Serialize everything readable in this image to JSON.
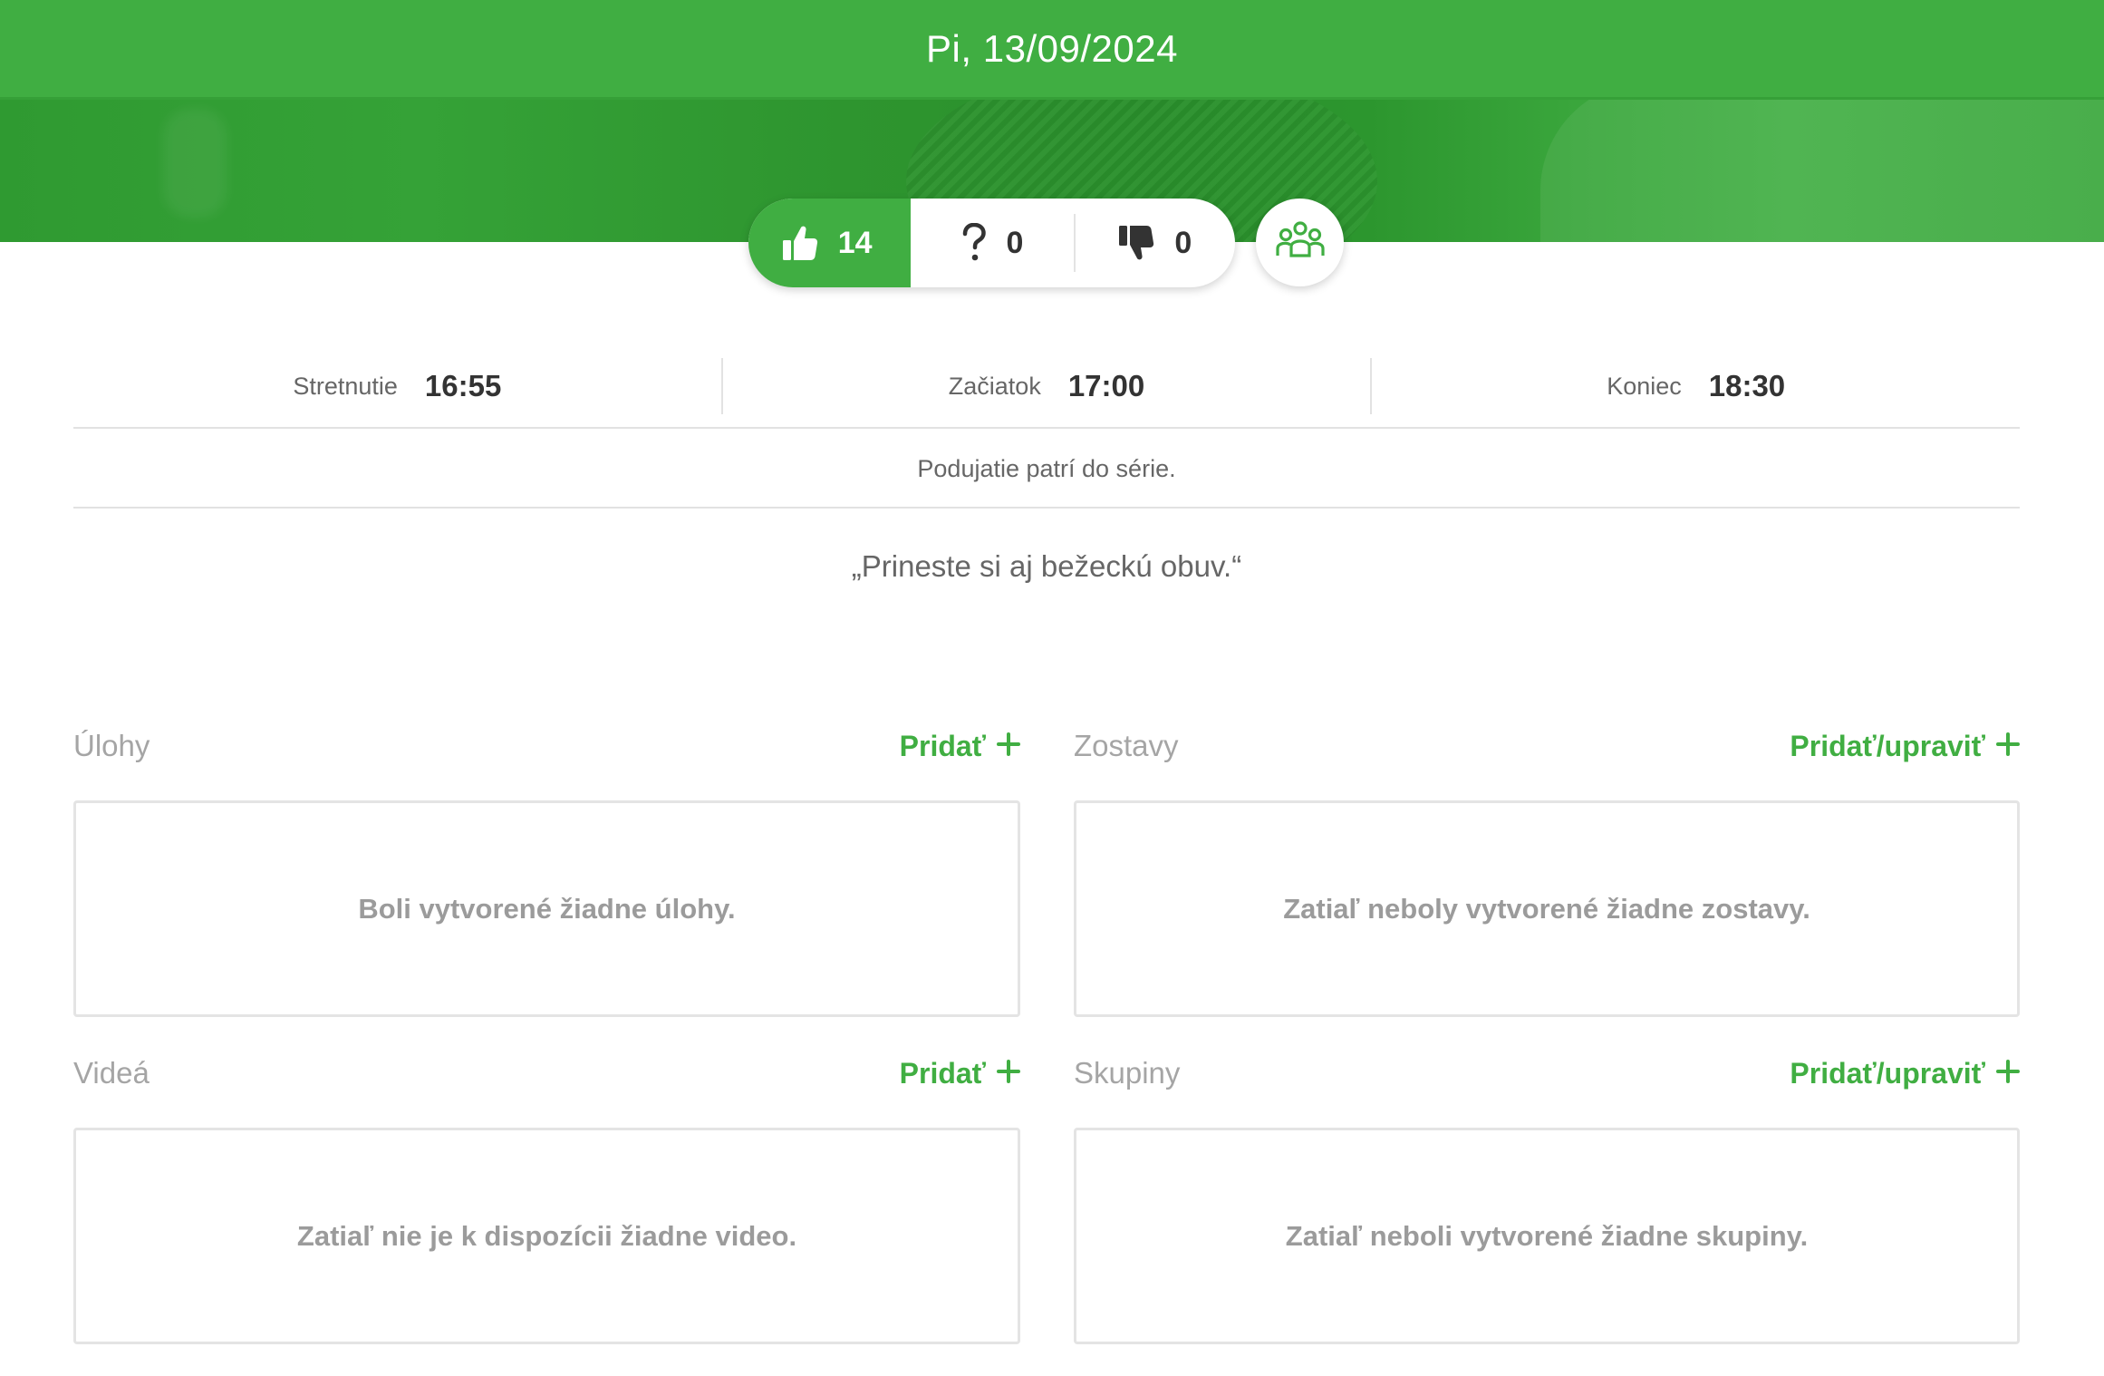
{
  "header": {
    "date": "Pi, 13/09/2024"
  },
  "rsvp": {
    "yes_count": "14",
    "maybe_count": "0",
    "no_count": "0"
  },
  "times": {
    "meeting_label": "Stretnutie",
    "meeting_value": "16:55",
    "start_label": "Začiatok",
    "start_value": "17:00",
    "end_label": "Koniec",
    "end_value": "18:30"
  },
  "series_text": "Podujatie patrí do série.",
  "note": "„Prineste si aj bežeckú obuv.“",
  "sections": {
    "tasks": {
      "title": "Úlohy",
      "action": "Pridať",
      "empty": "Boli vytvorené žiadne úlohy."
    },
    "lineups": {
      "title": "Zostavy",
      "action": "Pridať/upraviť",
      "empty": "Zatiaľ neboly vytvorené žiadne zostavy."
    },
    "videos": {
      "title": "Videá",
      "action": "Pridať",
      "empty": "Zatiaľ nie je k dispozícii žiadne video."
    },
    "groups": {
      "title": "Skupiny",
      "action": "Pridať/upraviť",
      "empty": "Zatiaľ neboli vytvorené žiadne skupiny."
    }
  },
  "colors": {
    "accent": "#40ae42",
    "muted_text": "#a5a5a5",
    "border": "#e4e4e4"
  },
  "icons": {
    "yes": "thumbs-up-icon",
    "maybe": "question-mark-icon",
    "no": "thumbs-down-icon",
    "group": "group-icon",
    "add": "plus-icon"
  }
}
